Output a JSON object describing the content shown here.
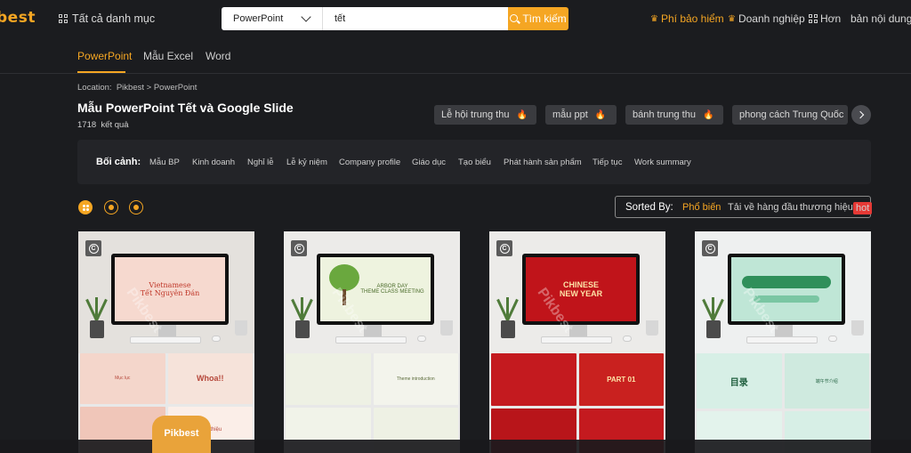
{
  "header": {
    "logo": "best",
    "all_categories": "Tất cả danh mục",
    "search_category": "PowerPoint",
    "search_value": "tết",
    "search_button": "Tìm kiếm",
    "premium": "Phí bảo hiểm",
    "business": "Doanh nghiệp",
    "more": "Hơn",
    "copyright": "bản nội dung"
  },
  "tabs": [
    "PowerPoint",
    "Mẫu Excel",
    "Word"
  ],
  "location": {
    "label": "Location:",
    "crumb1": "Pikbest",
    "sep": ">",
    "crumb2": "PowerPoint"
  },
  "page": {
    "title": "Mẫu PowerPoint Tết và Google Slide",
    "count": "1718",
    "count_label": "kết quả"
  },
  "chips": [
    "Lễ hội trung thu",
    "mẫu ppt",
    "bánh trung thu",
    "phong cách Trung Quốc"
  ],
  "context": {
    "label": "Bối cảnh:",
    "items": [
      "Mẫu BP",
      "Kinh doanh",
      "Nghỉ lễ",
      "Lễ kỷ niệm",
      "Company profile",
      "Giáo dục",
      "Tạo biểu",
      "Phát hành sản phẩm",
      "Tiếp tục",
      "Work summary"
    ]
  },
  "sort": {
    "label": "Sorted By:",
    "options": [
      "Phổ biến",
      "Tải về hàng đầu",
      "thương hiệu mới"
    ],
    "hot": "hot"
  },
  "cards": [
    {
      "screen_title": "Vietnamese",
      "screen_sub": "Tết Nguyên Đán",
      "t1": "Mục lục",
      "t2": "Whoa!!",
      "t3": "",
      "t4": "Giới thiệu"
    },
    {
      "screen_title": "ARBOR DAY",
      "screen_sub": "THEME CLASS MEETING",
      "t1": "",
      "t2": "Theme introduction",
      "t3": "",
      "t4": ""
    },
    {
      "screen_title": "CHINESE",
      "screen_sub": "NEW YEAR",
      "t1": "",
      "t2": "PART 01",
      "t3": "",
      "t4": ""
    },
    {
      "screen_title": "",
      "screen_sub": "",
      "t1": "目录",
      "t2": "端午节介绍",
      "t3": "",
      "t4": ""
    }
  ],
  "watermark": "Pikbest",
  "badge": "Pikbest",
  "colors": {
    "accent": "#f5a623",
    "bg": "#1b1c1f"
  }
}
